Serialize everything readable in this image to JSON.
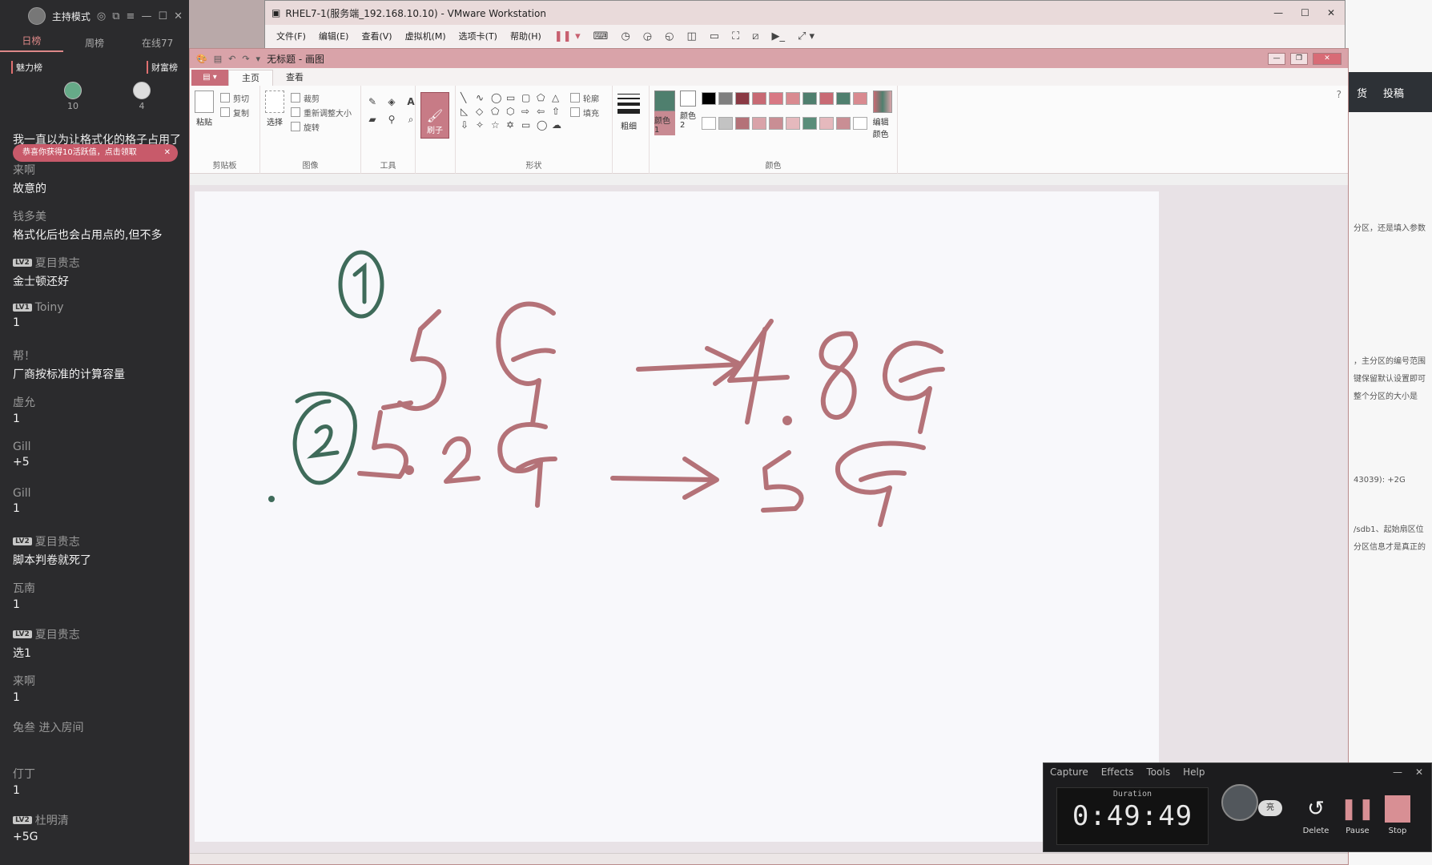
{
  "chat": {
    "mode_label": "主持模式",
    "tabs": [
      "日榜",
      "周榜",
      "在线77"
    ],
    "boards": [
      "魅力榜",
      "财富榜"
    ],
    "top_users": [
      {
        "count": "10"
      },
      {
        "count": "4"
      }
    ],
    "notice": "恭喜你获得10活跃值，点击领取",
    "first_message": "我一直以为让格式化的格子占用了",
    "messages": [
      {
        "name": "来啊",
        "level": "",
        "text": "故意的"
      },
      {
        "name": "钱多美",
        "level": "",
        "text": "格式化后也会占用点的,但不多"
      },
      {
        "name": "夏目贵志",
        "level": "LV2",
        "text": "金士顿还好"
      },
      {
        "name": "Toiny",
        "level": "LV1",
        "text": "1"
      },
      {
        "name": "帮！",
        "level": "",
        "text": "厂商按标准的计算容量"
      },
      {
        "name": "虚允",
        "level": "",
        "text": "1"
      },
      {
        "name": "Gill",
        "level": "",
        "text": "+5"
      },
      {
        "name": "Gill",
        "level": "",
        "text": "1"
      },
      {
        "name": "夏目贵志",
        "level": "LV2",
        "text": "脚本判卷就死了"
      },
      {
        "name": "瓦南",
        "level": "",
        "text": "1"
      },
      {
        "name": "夏目贵志",
        "level": "LV2",
        "text": "选1"
      },
      {
        "name": "来啊",
        "level": "",
        "text": "1"
      },
      {
        "name": "兔叁 进入房间",
        "level": "",
        "text": ""
      },
      {
        "name": "仃丁",
        "level": "",
        "text": "1"
      },
      {
        "name": "杜明清",
        "level": "LV2",
        "text": "+5G"
      }
    ]
  },
  "vmware": {
    "title": "RHEL7-1(服务端_192.168.10.10) - VMware Workstation",
    "menu": [
      "文件(F)",
      "编辑(E)",
      "查看(V)",
      "虚拟机(M)",
      "选项卡(T)",
      "帮助(H)"
    ]
  },
  "docstrip": {
    "band_items": [
      "货",
      "投稿"
    ],
    "lines": [
      "分区，还是填入参数",
      "，主分区的编号范围",
      "键保留默认设置即可",
      "整个分区的大小是",
      "43039): +2G",
      "/sdb1、起始扇区位",
      "分区信息才是真正的"
    ]
  },
  "paint": {
    "title": "无标题 - 画图",
    "file_button": "▤ ▾",
    "tabs": [
      "主页",
      "查看"
    ],
    "groups": {
      "clipboard": {
        "label": "剪贴板",
        "paste": "粘贴",
        "cut": "剪切",
        "copy": "复制"
      },
      "image": {
        "label": "图像",
        "select": "选择",
        "crop": "裁剪",
        "resize": "重新调整大小",
        "rotate": "旋转"
      },
      "tools": {
        "label": "工具"
      },
      "brush": {
        "label": "刷子"
      },
      "shapes": {
        "label": "形状",
        "outline": "轮廓",
        "fill": "填充"
      },
      "size": {
        "label": "粗细"
      },
      "colors": {
        "label": "颜色",
        "color1": "颜色 1",
        "color2": "颜色 2",
        "edit": "编辑颜色"
      }
    },
    "colors": {
      "color1": "#4f7f6e",
      "color2": "#ffffff",
      "ink_green": "#3f6b5a",
      "ink_red": "#b47278",
      "palette": [
        "#000000",
        "#7f7f7f",
        "#8a3a44",
        "#c86a74",
        "#d87884",
        "#d98a90",
        "#4f7f6e",
        "#c86a74",
        "#4f7f6e",
        "#d98a90",
        "#ffffff",
        "#c3c3c3",
        "#b47278",
        "#d9a3a9",
        "#c98e94",
        "#e5b9bd",
        "#5a8d7a",
        "#e5b9bd",
        "#c98e94",
        "#ffffff"
      ]
    },
    "drawing": {
      "circle1": "①",
      "circle2": "②",
      "line1_left": "5G",
      "line1_right": "4.8G",
      "line2_left": "5.2G",
      "line2_right": "5G",
      "arrow": "→"
    }
  },
  "recorder": {
    "menu": [
      "Capture",
      "Effects",
      "Tools",
      "Help"
    ],
    "duration_label": "Duration",
    "time": "0:49:49",
    "bubble": "亮",
    "buttons": {
      "delete": "Delete",
      "pause": "Pause",
      "stop": "Stop"
    }
  }
}
